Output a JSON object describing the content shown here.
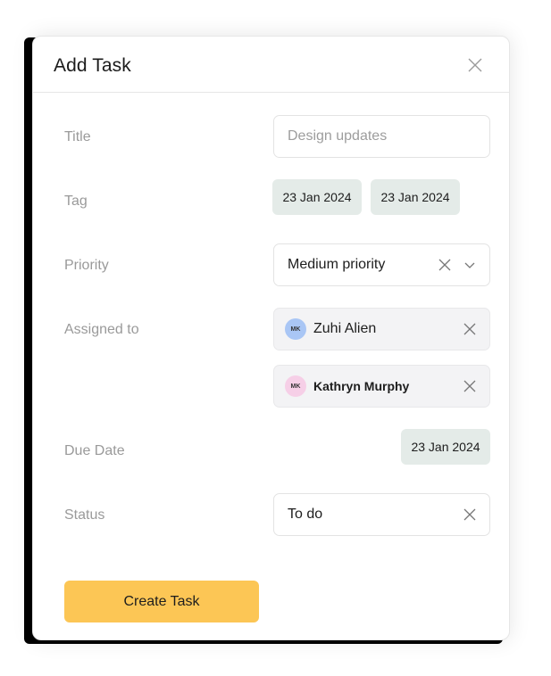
{
  "dialog": {
    "title": "Add Task",
    "close_icon": "close-icon"
  },
  "form": {
    "title_label": "Title",
    "title_placeholder": "Design updates",
    "tag_label": "Tag",
    "tags": [
      "23 Jan 2024",
      "23 Jan 2024"
    ],
    "priority_label": "Priority",
    "priority_value": "Medium priority",
    "assigned_label": "Assigned to",
    "assignees": [
      {
        "initials": "MK",
        "name": "Zuhi Alien",
        "avatar_color": "#a9c6f5"
      },
      {
        "initials": "MK",
        "name": "Kathryn Murphy",
        "avatar_color": "#f6cfe7"
      }
    ],
    "due_label": "Due Date",
    "due_value": "23 Jan 2024",
    "status_label": "Status",
    "status_value": "To do"
  },
  "actions": {
    "create_label": "Create Task"
  },
  "colors": {
    "accent": "#fcc655",
    "chip_bg": "#e4ebe8",
    "filled_bg": "#f3f3f5"
  }
}
